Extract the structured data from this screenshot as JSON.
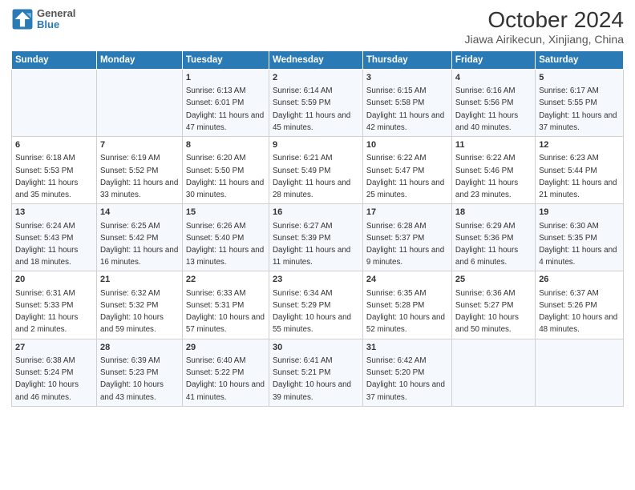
{
  "header": {
    "title": "October 2024",
    "subtitle": "Jiawa Airikecun, Xinjiang, China",
    "logo_line1": "General",
    "logo_line2": "Blue"
  },
  "weekdays": [
    "Sunday",
    "Monday",
    "Tuesday",
    "Wednesday",
    "Thursday",
    "Friday",
    "Saturday"
  ],
  "weeks": [
    [
      {
        "day": "",
        "sunrise": "",
        "sunset": "",
        "daylight": ""
      },
      {
        "day": "",
        "sunrise": "",
        "sunset": "",
        "daylight": ""
      },
      {
        "day": "1",
        "sunrise": "Sunrise: 6:13 AM",
        "sunset": "Sunset: 6:01 PM",
        "daylight": "Daylight: 11 hours and 47 minutes."
      },
      {
        "day": "2",
        "sunrise": "Sunrise: 6:14 AM",
        "sunset": "Sunset: 5:59 PM",
        "daylight": "Daylight: 11 hours and 45 minutes."
      },
      {
        "day": "3",
        "sunrise": "Sunrise: 6:15 AM",
        "sunset": "Sunset: 5:58 PM",
        "daylight": "Daylight: 11 hours and 42 minutes."
      },
      {
        "day": "4",
        "sunrise": "Sunrise: 6:16 AM",
        "sunset": "Sunset: 5:56 PM",
        "daylight": "Daylight: 11 hours and 40 minutes."
      },
      {
        "day": "5",
        "sunrise": "Sunrise: 6:17 AM",
        "sunset": "Sunset: 5:55 PM",
        "daylight": "Daylight: 11 hours and 37 minutes."
      }
    ],
    [
      {
        "day": "6",
        "sunrise": "Sunrise: 6:18 AM",
        "sunset": "Sunset: 5:53 PM",
        "daylight": "Daylight: 11 hours and 35 minutes."
      },
      {
        "day": "7",
        "sunrise": "Sunrise: 6:19 AM",
        "sunset": "Sunset: 5:52 PM",
        "daylight": "Daylight: 11 hours and 33 minutes."
      },
      {
        "day": "8",
        "sunrise": "Sunrise: 6:20 AM",
        "sunset": "Sunset: 5:50 PM",
        "daylight": "Daylight: 11 hours and 30 minutes."
      },
      {
        "day": "9",
        "sunrise": "Sunrise: 6:21 AM",
        "sunset": "Sunset: 5:49 PM",
        "daylight": "Daylight: 11 hours and 28 minutes."
      },
      {
        "day": "10",
        "sunrise": "Sunrise: 6:22 AM",
        "sunset": "Sunset: 5:47 PM",
        "daylight": "Daylight: 11 hours and 25 minutes."
      },
      {
        "day": "11",
        "sunrise": "Sunrise: 6:22 AM",
        "sunset": "Sunset: 5:46 PM",
        "daylight": "Daylight: 11 hours and 23 minutes."
      },
      {
        "day": "12",
        "sunrise": "Sunrise: 6:23 AM",
        "sunset": "Sunset: 5:44 PM",
        "daylight": "Daylight: 11 hours and 21 minutes."
      }
    ],
    [
      {
        "day": "13",
        "sunrise": "Sunrise: 6:24 AM",
        "sunset": "Sunset: 5:43 PM",
        "daylight": "Daylight: 11 hours and 18 minutes."
      },
      {
        "day": "14",
        "sunrise": "Sunrise: 6:25 AM",
        "sunset": "Sunset: 5:42 PM",
        "daylight": "Daylight: 11 hours and 16 minutes."
      },
      {
        "day": "15",
        "sunrise": "Sunrise: 6:26 AM",
        "sunset": "Sunset: 5:40 PM",
        "daylight": "Daylight: 11 hours and 13 minutes."
      },
      {
        "day": "16",
        "sunrise": "Sunrise: 6:27 AM",
        "sunset": "Sunset: 5:39 PM",
        "daylight": "Daylight: 11 hours and 11 minutes."
      },
      {
        "day": "17",
        "sunrise": "Sunrise: 6:28 AM",
        "sunset": "Sunset: 5:37 PM",
        "daylight": "Daylight: 11 hours and 9 minutes."
      },
      {
        "day": "18",
        "sunrise": "Sunrise: 6:29 AM",
        "sunset": "Sunset: 5:36 PM",
        "daylight": "Daylight: 11 hours and 6 minutes."
      },
      {
        "day": "19",
        "sunrise": "Sunrise: 6:30 AM",
        "sunset": "Sunset: 5:35 PM",
        "daylight": "Daylight: 11 hours and 4 minutes."
      }
    ],
    [
      {
        "day": "20",
        "sunrise": "Sunrise: 6:31 AM",
        "sunset": "Sunset: 5:33 PM",
        "daylight": "Daylight: 11 hours and 2 minutes."
      },
      {
        "day": "21",
        "sunrise": "Sunrise: 6:32 AM",
        "sunset": "Sunset: 5:32 PM",
        "daylight": "Daylight: 10 hours and 59 minutes."
      },
      {
        "day": "22",
        "sunrise": "Sunrise: 6:33 AM",
        "sunset": "Sunset: 5:31 PM",
        "daylight": "Daylight: 10 hours and 57 minutes."
      },
      {
        "day": "23",
        "sunrise": "Sunrise: 6:34 AM",
        "sunset": "Sunset: 5:29 PM",
        "daylight": "Daylight: 10 hours and 55 minutes."
      },
      {
        "day": "24",
        "sunrise": "Sunrise: 6:35 AM",
        "sunset": "Sunset: 5:28 PM",
        "daylight": "Daylight: 10 hours and 52 minutes."
      },
      {
        "day": "25",
        "sunrise": "Sunrise: 6:36 AM",
        "sunset": "Sunset: 5:27 PM",
        "daylight": "Daylight: 10 hours and 50 minutes."
      },
      {
        "day": "26",
        "sunrise": "Sunrise: 6:37 AM",
        "sunset": "Sunset: 5:26 PM",
        "daylight": "Daylight: 10 hours and 48 minutes."
      }
    ],
    [
      {
        "day": "27",
        "sunrise": "Sunrise: 6:38 AM",
        "sunset": "Sunset: 5:24 PM",
        "daylight": "Daylight: 10 hours and 46 minutes."
      },
      {
        "day": "28",
        "sunrise": "Sunrise: 6:39 AM",
        "sunset": "Sunset: 5:23 PM",
        "daylight": "Daylight: 10 hours and 43 minutes."
      },
      {
        "day": "29",
        "sunrise": "Sunrise: 6:40 AM",
        "sunset": "Sunset: 5:22 PM",
        "daylight": "Daylight: 10 hours and 41 minutes."
      },
      {
        "day": "30",
        "sunrise": "Sunrise: 6:41 AM",
        "sunset": "Sunset: 5:21 PM",
        "daylight": "Daylight: 10 hours and 39 minutes."
      },
      {
        "day": "31",
        "sunrise": "Sunrise: 6:42 AM",
        "sunset": "Sunset: 5:20 PM",
        "daylight": "Daylight: 10 hours and 37 minutes."
      },
      {
        "day": "",
        "sunrise": "",
        "sunset": "",
        "daylight": ""
      },
      {
        "day": "",
        "sunrise": "",
        "sunset": "",
        "daylight": ""
      }
    ]
  ]
}
